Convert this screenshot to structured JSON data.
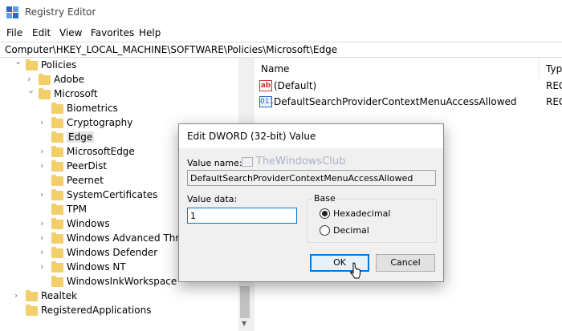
{
  "window": {
    "title": "Registry Editor"
  },
  "menu": [
    "File",
    "Edit",
    "View",
    "Favorites",
    "Help"
  ],
  "address": "Computer\\HKEY_LOCAL_MACHINE\\SOFTWARE\\Policies\\Microsoft\\Edge",
  "tree": [
    {
      "label": "Policies",
      "level": 0,
      "chevron": "open"
    },
    {
      "label": "Adobe",
      "level": 1,
      "chevron": "closed"
    },
    {
      "label": "Microsoft",
      "level": 1,
      "chevron": "open"
    },
    {
      "label": "Biometrics",
      "level": 2,
      "chevron": "none"
    },
    {
      "label": "Cryptography",
      "level": 2,
      "chevron": "closed"
    },
    {
      "label": "Edge",
      "level": 2,
      "chevron": "none",
      "selected": true
    },
    {
      "label": "MicrosoftEdge",
      "level": 2,
      "chevron": "closed"
    },
    {
      "label": "PeerDist",
      "level": 2,
      "chevron": "closed"
    },
    {
      "label": "Peernet",
      "level": 2,
      "chevron": "none"
    },
    {
      "label": "SystemCertificates",
      "level": 2,
      "chevron": "closed"
    },
    {
      "label": "TPM",
      "level": 2,
      "chevron": "none"
    },
    {
      "label": "Windows",
      "level": 2,
      "chevron": "closed"
    },
    {
      "label": "Windows Advanced Threat",
      "level": 2,
      "chevron": "closed"
    },
    {
      "label": "Windows Defender",
      "level": 2,
      "chevron": "closed"
    },
    {
      "label": "Windows NT",
      "level": 2,
      "chevron": "closed"
    },
    {
      "label": "WindowsInkWorkspace",
      "level": 2,
      "chevron": "none"
    },
    {
      "label": "Realtek",
      "level": 0,
      "chevron": "closed"
    },
    {
      "label": "RegisteredApplications",
      "level": 0,
      "chevron": "none"
    }
  ],
  "list": {
    "columns": [
      "Name",
      "Typ"
    ],
    "rows": [
      {
        "icon": "string-value-icon",
        "icon_text": "ab",
        "name": "(Default)",
        "type": "REG"
      },
      {
        "icon": "dword-value-icon",
        "icon_text": "011",
        "name": "DefaultSearchProviderContextMenuAccessAllowed",
        "type": "REG"
      }
    ]
  },
  "dialog": {
    "title": "Edit DWORD (32-bit) Value",
    "watermark": "TheWindowsClub",
    "value_name_label": "Value name:",
    "value_name": "DefaultSearchProviderContextMenuAccessAllowed",
    "value_data_label": "Value data:",
    "value_data": "1",
    "base_label": "Base",
    "base_options": [
      "Hexadecimal",
      "Decimal"
    ],
    "base_selected": "Hexadecimal",
    "ok_label": "OK",
    "cancel_label": "Cancel"
  },
  "colors": {
    "accent": "#0078d7",
    "folder": "#f2cf6a"
  }
}
